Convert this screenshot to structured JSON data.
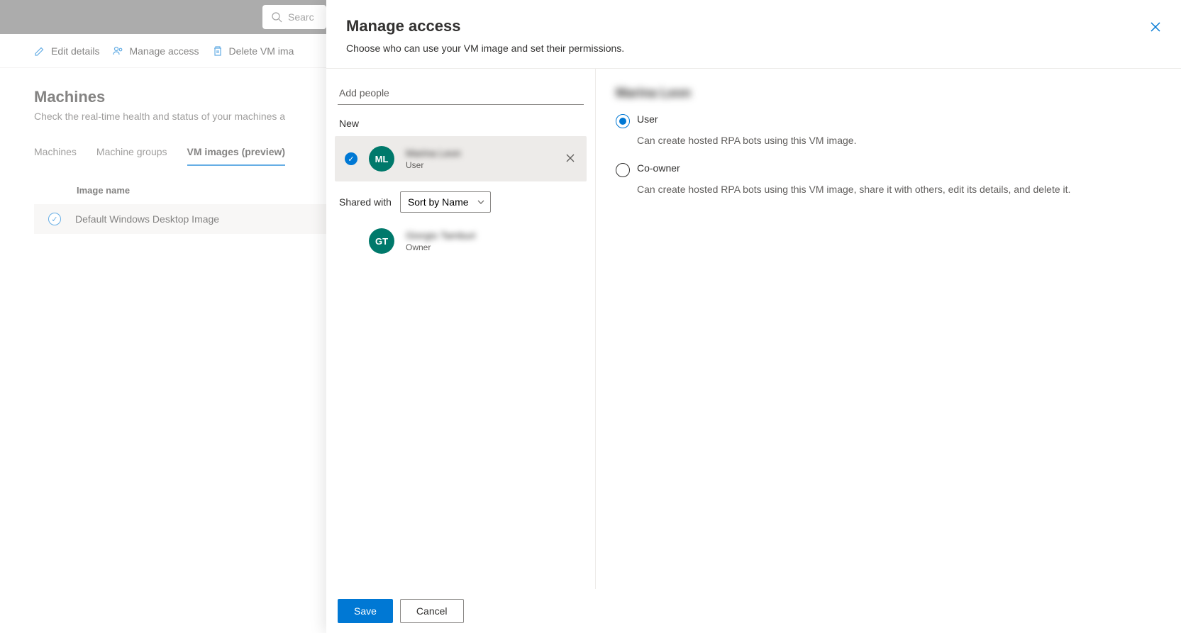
{
  "search": {
    "placeholder": "Searc"
  },
  "commandBar": {
    "editDetails": "Edit details",
    "manageAccess": "Manage access",
    "deleteVmImage": "Delete VM ima"
  },
  "page": {
    "title": "Machines",
    "subtitle": "Check the real-time health and status of your machines a"
  },
  "tabs": {
    "machines": "Machines",
    "machineGroups": "Machine groups",
    "vmImages": "VM images (preview)"
  },
  "table": {
    "header": "Image name",
    "row1": "Default Windows Desktop Image"
  },
  "panel": {
    "title": "Manage access",
    "subtitle": "Choose who can use your VM image and set their permissions.",
    "addPeoplePlaceholder": "Add people",
    "newLabel": "New",
    "sharedWithLabel": "Shared with",
    "sortBy": "Sort by Name",
    "people": {
      "new": {
        "initials": "ML",
        "name": "Marina Leon",
        "role": "User"
      },
      "shared": {
        "initials": "GT",
        "name": "Giorgio Tamburi",
        "role": "Owner"
      }
    },
    "selectedName": "Marina Leon",
    "permissions": {
      "user": {
        "label": "User",
        "desc": "Can create hosted RPA bots using this VM image."
      },
      "coOwner": {
        "label": "Co-owner",
        "desc": "Can create hosted RPA bots using this VM image, share it with others, edit its details, and delete it."
      }
    },
    "footer": {
      "save": "Save",
      "cancel": "Cancel"
    }
  }
}
